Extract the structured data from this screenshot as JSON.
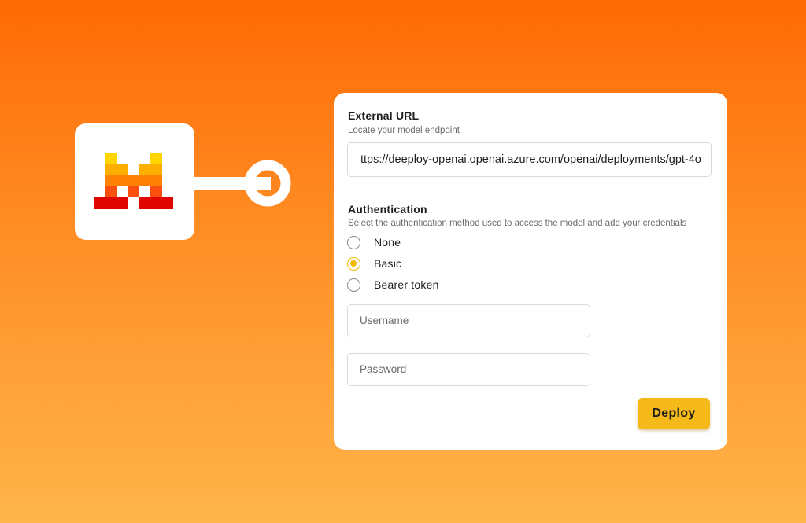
{
  "logo": {
    "icon": "mistral-logo-icon"
  },
  "connector": {
    "icon": "plug-connector-icon"
  },
  "external_url": {
    "title": "External URL",
    "subtitle": "Locate your model endpoint",
    "value": "ttps://deeploy-openai.openai.azure.com/openai/deployments/gpt-4o"
  },
  "authentication": {
    "title": "Authentication",
    "subtitle": "Select the authentication method used to access the model and add your credentials",
    "options": [
      {
        "label": "None",
        "selected": false
      },
      {
        "label": "Basic",
        "selected": true
      },
      {
        "label": "Bearer token",
        "selected": false
      }
    ]
  },
  "username": {
    "placeholder": "Username",
    "value": ""
  },
  "password": {
    "placeholder": "Password",
    "value": ""
  },
  "deploy_button": {
    "label": "Deploy"
  },
  "colors": {
    "background_top": "#ff6a05",
    "background_bottom": "#ffb549",
    "accent": "#f5b800",
    "button": "#f6b91a"
  }
}
